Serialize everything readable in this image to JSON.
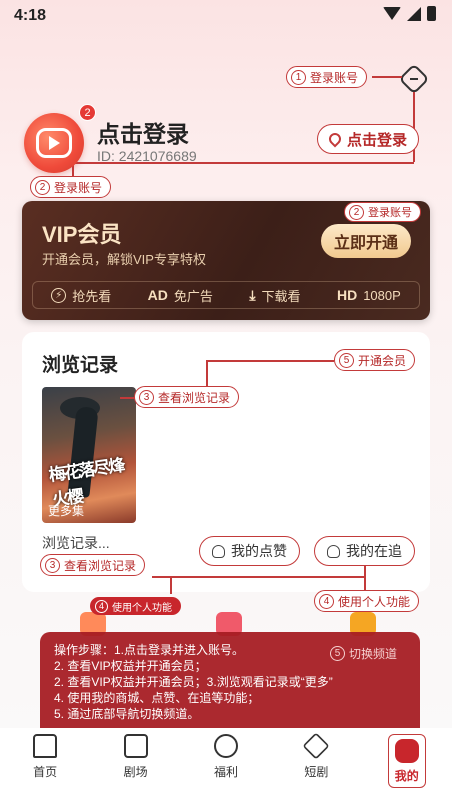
{
  "status_bar": {
    "time": "4:18"
  },
  "profile": {
    "title": "点击登录",
    "user_id": "ID: 2421076689",
    "badge_count": "2",
    "login_button": "点击登录"
  },
  "callouts": {
    "c1": {
      "num": "1",
      "label": "登录账号"
    },
    "c2a": {
      "num": "2",
      "label": "登录账号"
    },
    "c2b": {
      "num": "2",
      "label": "登录账号"
    },
    "c3a": {
      "num": "3",
      "label": "查看浏览记录"
    },
    "c3b": {
      "num": "3",
      "label": "查看浏览记录"
    },
    "c4a": {
      "num": "4",
      "label": "使用个人功能"
    },
    "c4b": {
      "num": "4",
      "label": "使用个人功能"
    },
    "c5": {
      "num": "5",
      "label": "开通会员"
    }
  },
  "vip": {
    "title": "VIP会员",
    "subtitle": "开通会员，解锁VIP专享特权",
    "button": "立即开通",
    "features": [
      {
        "icon": "lightning-icon",
        "label": "抢先看"
      },
      {
        "icon": "ad-icon",
        "icon_text": "AD",
        "label": "免广告"
      },
      {
        "icon": "download-icon",
        "label": "下载看"
      },
      {
        "icon": "hd-icon",
        "icon_text": "HD",
        "label": "1080P"
      }
    ]
  },
  "history": {
    "title": "浏览记录",
    "poster_title": "梅花落尽烽火樱",
    "poster_label": "更多集",
    "item_label": "浏览记录...",
    "likes_button": "我的点赞",
    "following_button": "我的在追"
  },
  "tutorial": {
    "switch_num": "5",
    "switch_label": "切换频道",
    "steps": [
      "操作步骤：1.点击登录并进入账号。",
      "2. 查看VIP权益并开通会员；",
      "2. 查看VIP权益并开通会员；3.浏览观看记录或“更多”",
      "4. 使用我的商城、点赞、在追等功能；",
      "5. 通过底部导航切换频道。"
    ]
  },
  "nav": [
    {
      "label": "首页",
      "icon": "home-icon"
    },
    {
      "label": "剧场",
      "icon": "theater-icon"
    },
    {
      "label": "福利",
      "icon": "welfare-icon"
    },
    {
      "label": "短剧",
      "icon": "short-drama-icon"
    },
    {
      "label": "我的",
      "icon": "profile-icon"
    }
  ],
  "colors": {
    "accent": "#c33a3a",
    "vip_bg": "#3c1f18",
    "vip_gold": "#f1c98f",
    "overlay": "#a61c22"
  }
}
